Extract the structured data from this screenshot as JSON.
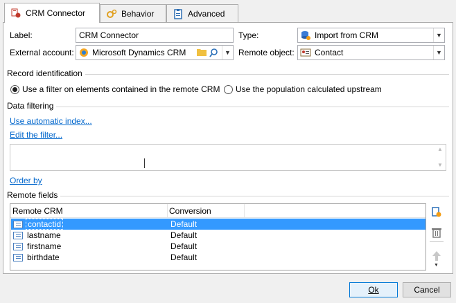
{
  "tabs": [
    {
      "label": "CRM Connector",
      "icon": "crm-connector-icon"
    },
    {
      "label": "Behavior",
      "icon": "gears-icon"
    },
    {
      "label": "Advanced",
      "icon": "clipboard-icon"
    }
  ],
  "form": {
    "label_caption": "Label:",
    "label_value": "CRM Connector",
    "type_caption": "Type:",
    "type_value": "Import from CRM",
    "external_account_caption": "External account:",
    "external_account_value": "Microsoft Dynamics CRM",
    "remote_object_caption": "Remote object:",
    "remote_object_value": "Contact"
  },
  "record_identification": {
    "title": "Record identification",
    "option_filter": "Use a filter on elements contained in the remote CRM",
    "option_population": "Use the population calculated upstream",
    "selected": "filter"
  },
  "data_filtering": {
    "title": "Data filtering",
    "use_automatic_index": "Use automatic index...",
    "edit_filter": "Edit the filter...",
    "order_by": "Order by"
  },
  "remote_fields": {
    "title": "Remote fields",
    "columns": [
      "Remote CRM",
      "Conversion"
    ],
    "rows": [
      {
        "field": "contactid",
        "conversion": "Default",
        "selected": true
      },
      {
        "field": "lastname",
        "conversion": "Default",
        "selected": false
      },
      {
        "field": "firstname",
        "conversion": "Default",
        "selected": false
      },
      {
        "field": "birthdate",
        "conversion": "Default",
        "selected": false
      }
    ]
  },
  "buttons": {
    "ok": "Ok",
    "cancel": "Cancel"
  },
  "colors": {
    "selection": "#3399ff",
    "link": "#0066cc"
  }
}
